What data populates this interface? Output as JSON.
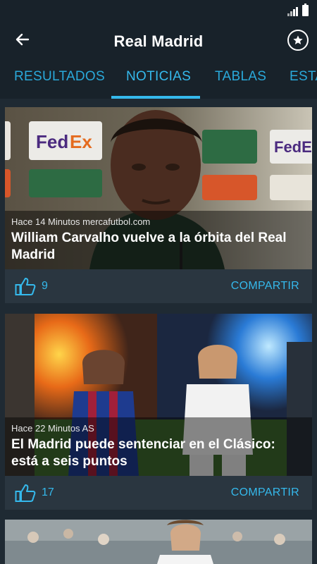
{
  "header": {
    "title": "Real Madrid",
    "back_icon": "arrow-left-icon",
    "favorite_icon": "star-circle-icon"
  },
  "status_bar": {
    "signal_icon": "cell-signal-icon",
    "battery_icon": "battery-icon"
  },
  "tabs": [
    {
      "label": "RESULTADOS",
      "active": false
    },
    {
      "label": "NOTICIAS",
      "active": true
    },
    {
      "label": "TABLAS",
      "active": false
    },
    {
      "label": "ESTA",
      "active": false
    }
  ],
  "colors": {
    "accent": "#35b9ec",
    "background": "#1f2a33",
    "card": "#2a3640",
    "bar": "#18222a"
  },
  "news": [
    {
      "meta": "Hace 14 Minutos mercafutbol.com",
      "headline": "William Carvalho vuelve a la órbita del Real Madrid",
      "likes": "9",
      "share_label": "COMPARTIR"
    },
    {
      "meta": "Hace 22 Minutos AS",
      "headline": "El Madrid puede sentenciar en el Clásico: está a seis puntos",
      "likes": "17",
      "share_label": "COMPARTIR"
    }
  ]
}
